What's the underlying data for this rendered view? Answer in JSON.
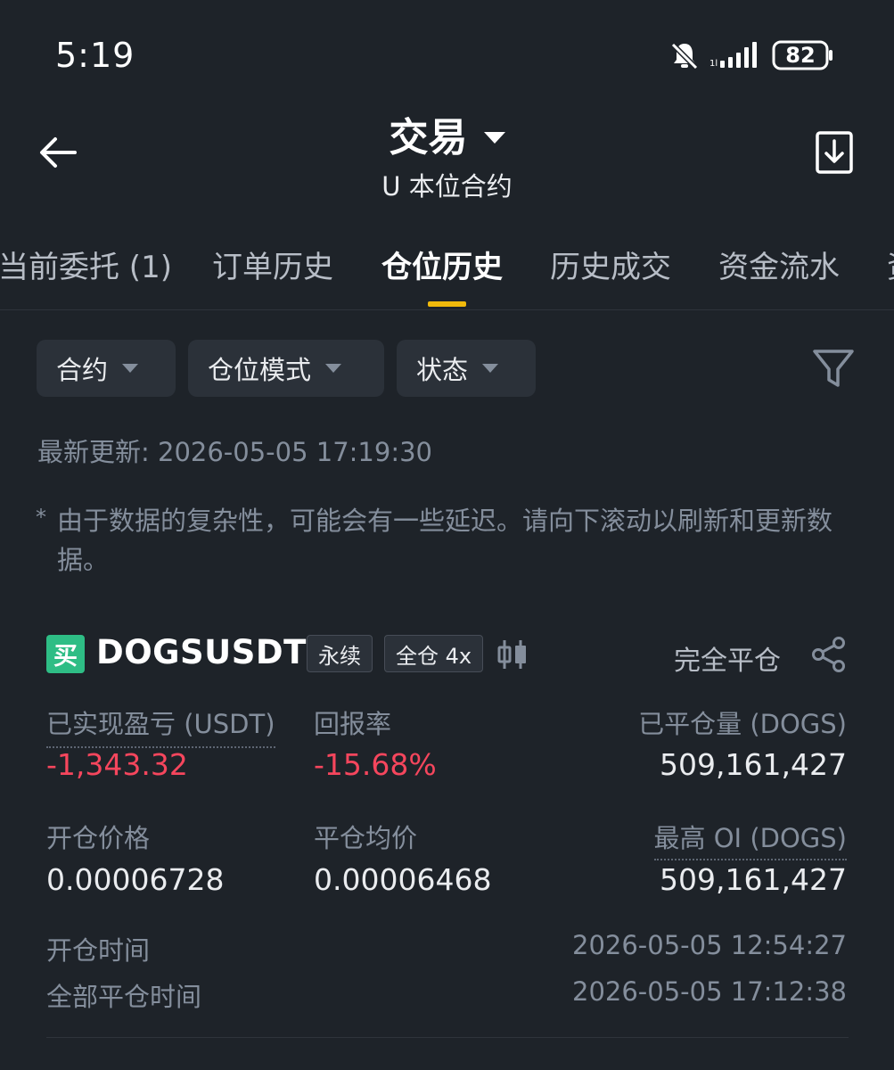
{
  "status_bar": {
    "time": "5:19",
    "battery": "82"
  },
  "header": {
    "title": "交易",
    "subtitle": "U 本位合约"
  },
  "tabs": [
    {
      "label": "当前委托 (1)",
      "active": false
    },
    {
      "label": "订单历史",
      "active": false
    },
    {
      "label": "仓位历史",
      "active": true
    },
    {
      "label": "历史成交",
      "active": false
    },
    {
      "label": "资金流水",
      "active": false
    },
    {
      "label": "资",
      "active": false
    }
  ],
  "filters": [
    {
      "label": "合约"
    },
    {
      "label": "仓位模式"
    },
    {
      "label": "状态"
    }
  ],
  "updated": "最新更新: 2026-05-05 17:19:30",
  "notice": {
    "star": "*",
    "text": "由于数据的复杂性，可能会有一些延迟。请向下滚动以刷新和更新数据。"
  },
  "position": {
    "side": "买",
    "symbol": "DOGSUSDT",
    "tag_type": "永续",
    "tag_margin": "全仓 4x",
    "status": "完全平仓",
    "realized_pnl_label": "已实现盈亏 (USDT)",
    "realized_pnl": "-1,343.32",
    "roi_label": "回报率",
    "roi": "-15.68%",
    "closed_qty_label": "已平仓量 (DOGS)",
    "closed_qty": "509,161,427",
    "entry_price_label": "开仓价格",
    "entry_price": "0.00006728",
    "close_avg_label": "平仓均价",
    "close_avg": "0.00006468",
    "max_oi_label": "最高 OI (DOGS)",
    "max_oi": "509,161,427",
    "open_time_label": "开仓时间",
    "open_time": "2026-05-05 12:54:27",
    "close_time_label": "全部平仓时间",
    "close_time": "2026-05-05 17:12:38"
  },
  "colors": {
    "background": "#1e2329",
    "accent": "#f0b90b",
    "buy": "#2ebd85",
    "loss": "#f6465d"
  }
}
